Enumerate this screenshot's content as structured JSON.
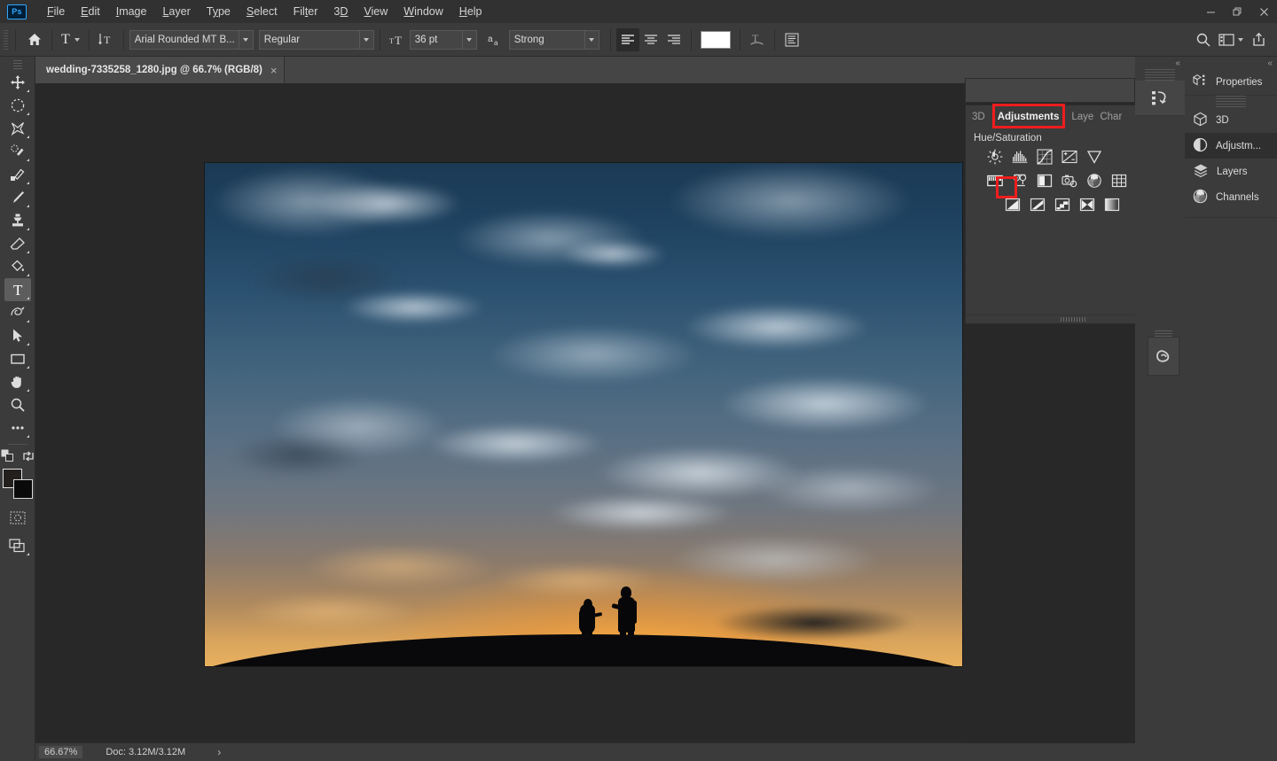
{
  "app": {
    "name": "Adobe Photoshop",
    "logo_text": "Ps"
  },
  "menubar": {
    "items": [
      {
        "label": "File",
        "accel": "F"
      },
      {
        "label": "Edit",
        "accel": "E"
      },
      {
        "label": "Image",
        "accel": "I"
      },
      {
        "label": "Layer",
        "accel": "L"
      },
      {
        "label": "Type",
        "accel": "y"
      },
      {
        "label": "Select",
        "accel": "S"
      },
      {
        "label": "Filter",
        "accel": "t"
      },
      {
        "label": "3D",
        "accel": "D"
      },
      {
        "label": "View",
        "accel": "V"
      },
      {
        "label": "Window",
        "accel": "W"
      },
      {
        "label": "Help",
        "accel": "H"
      }
    ],
    "window_controls": [
      {
        "name": "minimize",
        "glyph": "—"
      },
      {
        "name": "restore",
        "glyph": "❐"
      },
      {
        "name": "close",
        "glyph": "✕"
      }
    ]
  },
  "options_bar": {
    "home_icon": "home-icon",
    "tool_preset": {
      "icon": "type-tool-icon",
      "label": "T"
    },
    "text_orientation_icon": "toggle-text-orientation-icon",
    "font_family": "Arial Rounded MT B...",
    "font_style": "Regular",
    "font_size_icon": "font-size-icon",
    "font_size": "36 pt",
    "antialias_icon": "anti-aliasing-icon",
    "antialias_method": "Strong",
    "align": [
      {
        "name": "align-left",
        "active": true
      },
      {
        "name": "align-center",
        "active": false
      },
      {
        "name": "align-right",
        "active": false
      }
    ],
    "text_color": "#ffffff",
    "warp_text_icon": "warp-text-icon",
    "char_paragraph_icon": "character-paragraph-panels-icon",
    "right_icons": [
      {
        "name": "search-icon"
      },
      {
        "name": "workspace-arrange-icon"
      },
      {
        "name": "share-icon"
      }
    ]
  },
  "document_tabs": [
    {
      "title": "wedding-7335258_1280.jpg @ 66.7% (RGB/8)",
      "close": "×",
      "active": true
    }
  ],
  "toolbar": {
    "tools": [
      {
        "name": "move-tool",
        "active": false,
        "has_flyout": true
      },
      {
        "name": "elliptical-marquee-tool",
        "active": false,
        "has_flyout": true
      },
      {
        "name": "lasso-tool",
        "active": false,
        "has_flyout": true
      },
      {
        "name": "quick-selection-tool",
        "active": false,
        "has_flyout": true
      },
      {
        "name": "eyedropper-tool",
        "active": false,
        "has_flyout": true
      },
      {
        "name": "brush-tool",
        "active": false,
        "has_flyout": true
      },
      {
        "name": "clone-stamp-tool",
        "active": false,
        "has_flyout": true
      },
      {
        "name": "eraser-tool",
        "active": false,
        "has_flyout": true
      },
      {
        "name": "paint-bucket-tool",
        "active": false,
        "has_flyout": true
      },
      {
        "name": "type-tool",
        "active": true,
        "has_flyout": true
      },
      {
        "name": "pen-tool",
        "active": false,
        "has_flyout": true
      },
      {
        "name": "path-selection-tool",
        "active": false,
        "has_flyout": true
      },
      {
        "name": "rectangle-tool",
        "active": false,
        "has_flyout": true
      },
      {
        "name": "hand-tool",
        "active": false,
        "has_flyout": true
      },
      {
        "name": "zoom-tool",
        "active": false,
        "has_flyout": false
      },
      {
        "name": "edit-toolbar-tool",
        "active": false,
        "has_flyout": false
      }
    ],
    "foreground_color": "#231f1d",
    "background_color": "#0a0a0a",
    "default_colors_icon": "default-colors-icon",
    "swap_colors_icon": "swap-colors-icon",
    "quick_mask_icon": "quick-mask-mode-icon",
    "screen_mode_icon": "screen-mode-icon"
  },
  "canvas": {
    "image_alt": "silhouette of couple holding hands on hill at sunset",
    "sky_top_color": "#1b3a55",
    "sky_bottom_color": "#e8b05e",
    "silhouette_color": "#070709"
  },
  "statusbar": {
    "zoom": "66.67%",
    "doc_info": "Doc: 3.12M/3.12M",
    "expand_glyph": "›"
  },
  "adjustments_panel": {
    "tabs": [
      {
        "label": "3D",
        "active": false
      },
      {
        "label": "Adjustments",
        "active": true,
        "highlighted": true
      },
      {
        "label": "Laye",
        "active": false
      },
      {
        "label": "Char",
        "active": false
      }
    ],
    "overflow_glyph": "»",
    "menu_icon": "panel-menu-icon",
    "hover_label": "Hue/Saturation",
    "rows": [
      [
        {
          "name": "brightness-contrast-adjustment-icon",
          "title": "Brightness/Contrast",
          "highlighted": false
        },
        {
          "name": "levels-adjustment-icon",
          "title": "Levels",
          "highlighted": false
        },
        {
          "name": "curves-adjustment-icon",
          "title": "Curves",
          "highlighted": false
        },
        {
          "name": "exposure-adjustment-icon",
          "title": "Exposure",
          "highlighted": false
        },
        {
          "name": "vibrance-adjustment-icon",
          "title": "Vibrance",
          "highlighted": false
        }
      ],
      [
        {
          "name": "hue-saturation-adjustment-icon",
          "title": "Hue/Saturation",
          "highlighted": true
        },
        {
          "name": "color-balance-adjustment-icon",
          "title": "Color Balance",
          "highlighted": false
        },
        {
          "name": "black-and-white-adjustment-icon",
          "title": "Black & White",
          "highlighted": false
        },
        {
          "name": "photo-filter-adjustment-icon",
          "title": "Photo Filter",
          "highlighted": false
        },
        {
          "name": "channel-mixer-adjustment-icon",
          "title": "Channel Mixer",
          "highlighted": false
        },
        {
          "name": "color-lookup-adjustment-icon",
          "title": "Color Lookup",
          "highlighted": false
        }
      ],
      [
        {
          "name": "invert-adjustment-icon",
          "title": "Invert",
          "highlighted": false
        },
        {
          "name": "posterize-adjustment-icon",
          "title": "Posterize",
          "highlighted": false
        },
        {
          "name": "threshold-adjustment-icon",
          "title": "Threshold",
          "highlighted": false
        },
        {
          "name": "selective-color-adjustment-icon",
          "title": "Selective Color",
          "highlighted": false
        },
        {
          "name": "gradient-map-adjustment-icon",
          "title": "Gradient Map",
          "highlighted": false
        }
      ]
    ],
    "annotation_color": "#ee1d1d"
  },
  "right_dock": {
    "collapse_glyph": "«",
    "history_icon": "history-panel-icon",
    "libraries_icon": "creative-cloud-libraries-icon",
    "items": [
      {
        "label": "Properties",
        "icon": "properties-panel-icon",
        "active": false
      },
      {
        "label": "3D",
        "icon": "3d-panel-icon",
        "active": false
      },
      {
        "label": "Adjustm...",
        "icon": "adjustments-panel-icon",
        "active": true
      },
      {
        "label": "Layers",
        "icon": "layers-panel-icon",
        "active": false
      },
      {
        "label": "Channels",
        "icon": "channels-panel-icon",
        "active": false
      }
    ]
  }
}
